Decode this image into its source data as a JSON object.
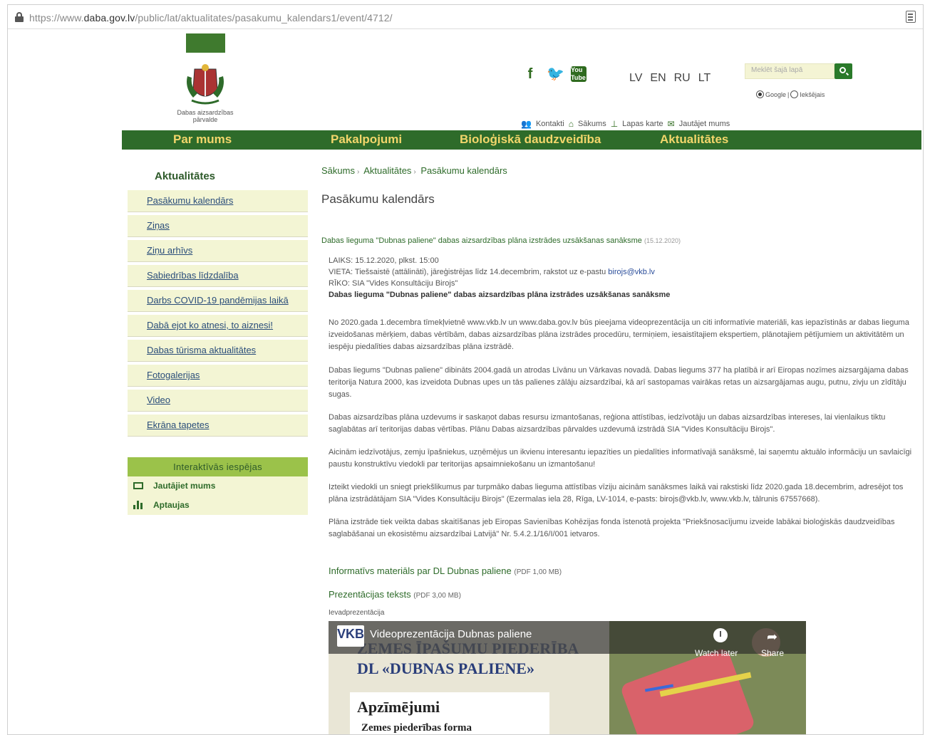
{
  "browser": {
    "url_prefix": "https://www.",
    "url_domain": "daba.gov.lv",
    "url_path": "/public/lat/aktualitates/pasakumu_kalendars1/event/4712/"
  },
  "header": {
    "logo_text": "Dabas aizsardzības pārvalde",
    "social": [
      "f",
      "🐦",
      "You Tube"
    ],
    "languages": [
      "LV",
      "EN",
      "RU",
      "LT"
    ],
    "search_placeholder": "Meklēt šajā lapā",
    "search_options": [
      "Google",
      "Iekšējais"
    ],
    "top_links": [
      "Kontakti",
      "Sākums",
      "Lapas karte",
      "Jautājet mums"
    ]
  },
  "nav": {
    "items": [
      "Par mums",
      "Pakalpojumi",
      "Bioloģiskā daudzveidība",
      "Aktualitātes"
    ]
  },
  "sidebar": {
    "title": "Aktualitātes",
    "items": [
      "Pasākumu kalendārs",
      "Ziņas",
      "Ziņu arhīvs",
      "Sabiedrības līdzdalība",
      "Darbs COVID-19 pandēmijas laikā",
      "Dabā ejot ko atnesi, to aiznesi!",
      "Dabas tūrisma aktualitātes",
      "Fotogalerijas",
      "Video",
      "Ekrāna tapetes"
    ],
    "interactive_title": "Interaktīvās iespējas",
    "interactive_items": [
      "Jautājiet mums",
      "Aptaujas"
    ]
  },
  "main": {
    "breadcrumb": [
      "Sākums",
      "Aktualitātes",
      "Pasākumu kalendārs"
    ],
    "page_title": "Pasākumu kalendārs",
    "event_title": "Dabas lieguma \"Dubnas paliene\" dabas aizsardzības plāna izstrādes uzsākšanas sanāksme",
    "event_date": "(15.12.2020)",
    "time_line": "LAIKS: 15.12.2020, plkst. 15:00",
    "place_line": "VIETA: Tiešsaistē (attālināti), jāreģistrējas līdz 14.decembrim, rakstot uz e-pastu ",
    "place_email": "birojs@vkb.lv",
    "organizer_line": "RĪKO: SIA \"Vides Konsultāciju Birojs\"",
    "bold_line": "Dabas lieguma \"Dubnas paliene\" dabas aizsardzības plāna izstrādes uzsākšanas sanāksme",
    "paragraphs": [
      "No 2020.gada 1.decembra tīmekļvietnē www.vkb.lv un www.daba.gov.lv būs pieejama videoprezentācija un citi informatīvie materiāli, kas iepazīstinās ar dabas lieguma izveidošanas mērķiem, dabas vērtībām, dabas aizsardzības plāna izstrādes procedūru, termiņiem, iesaistītajiem ekspertiem, plānotajiem pētījumiem un aktivitātēm un iespēju piedalīties dabas aizsardzības plāna izstrādē.",
      "Dabas liegums \"Dubnas paliene\" dibināts 2004.gadā un atrodas Līvānu un Vārkavas novadā. Dabas liegums 377 ha platībā ir arī Eiropas nozīmes aizsargājama dabas teritorija Natura 2000, kas izveidota Dubnas upes un tās palienes zālāju aizsardzībai, kā arī sastopamas vairākas retas un aizsargājamas augu, putnu, zivju un zīdītāju sugas.",
      "Dabas aizsardzības plāna uzdevums ir saskaņot dabas resursu izmantošanas, reģiona attīstības, iedzīvotāju un dabas aizsardzības intereses, lai vienlaikus tiktu saglabātas arī teritorijas dabas vērtības. Plānu Dabas aizsardzības pārvaldes uzdevumā izstrādā SIA \"Vides Konsultāciju Birojs\".",
      "Aicinām iedzīvotājus, zemju īpašniekus, uzņēmējus un ikvienu interesantu iepazīties un piedalīties informatīvajā sanāksmē, lai saņemtu aktuālo informāciju un savlaicīgi paustu konstruktīvu viedokli par teritorijas apsaimniekošanu un izmantošanu!",
      "Izteikt viedokli un sniegt priekšlikumus par turpmāko dabas lieguma attīstības vīziju aicinām sanāksmes laikā vai rakstiski līdz 2020.gada 18.decembrim, adresējot tos plāna izstrādātājam SIA \"Vides Konsultāciju Birojs\" (Ezermalas iela 28, Rīga, LV-1014, e-pasts: birojs@vkb.lv, www.vkb.lv, tālrunis 67557668).",
      "Plāna izstrāde tiek veikta dabas skaitīšanas jeb Eiropas Savienības Kohēzijas fonda īstenotā projekta \"Priekšnosacījumu izveide labākai bioloģiskās daudzveidības saglabāšanai un ekosistēmu aizsardzībai Latvijā\" Nr. 5.4.2.1/16/I/001 ietvaros."
    ],
    "doc1": "Informatīvs materiāls par DL Dubnas paliene",
    "doc1_meta": "(PDF 1,00 MB)",
    "doc2": "Prezentācijas teksts",
    "doc2_meta": "(PDF 3,00 MB)",
    "video_label": "Ievadprezentācija",
    "video": {
      "logo": "VKB",
      "title": "Videoprezentācija Dubnas paliene",
      "watch_later": "Watch later",
      "share": "Share",
      "slide_line1": "ZEMES ĪPAŠUMU PIEDERĪBA",
      "slide_line2": "DL «DUBNAS PALIENE»",
      "legend_title": "Apzīmējumi",
      "legend_sub": "Zemes piederības forma"
    }
  }
}
